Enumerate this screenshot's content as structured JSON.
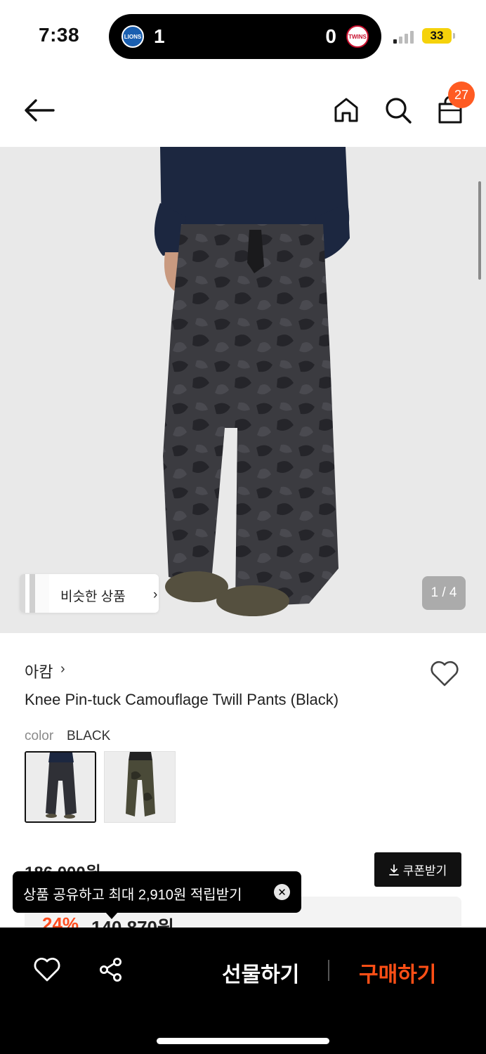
{
  "status_bar": {
    "time": "7:38",
    "live_activity": {
      "left_team": "LIONS",
      "left_score": "1",
      "right_score": "0",
      "right_team": "TWINS"
    },
    "battery": "33"
  },
  "nav": {
    "back_icon": "arrow-left-icon",
    "home_icon": "home-icon",
    "search_icon": "search-icon",
    "cart_icon": "shopping-bag-icon",
    "cart_count": "27"
  },
  "gallery": {
    "similar_label": "비슷한 상품",
    "similar_chevron": "›",
    "counter": "1 / 4"
  },
  "product": {
    "brand": "아캄",
    "brand_chevron": "›",
    "name": "Knee Pin-tuck Camouflage Twill Pants (Black)",
    "color_label": "color",
    "color_value": "BLACK",
    "original_price": "186,000원",
    "coupon_label": "쿠폰받기",
    "discount_rate": "24%",
    "sale_price": "140,870원"
  },
  "toast": {
    "message": "상품 공유하고 최대 2,910원 적립받기",
    "close_symbol": "✕"
  },
  "bottom_bar": {
    "gift_label": "선물하기",
    "buy_label": "구매하기"
  },
  "colors": {
    "accent": "#ff4f16",
    "badge": "#ff5b22",
    "battery": "#f5d20b"
  }
}
